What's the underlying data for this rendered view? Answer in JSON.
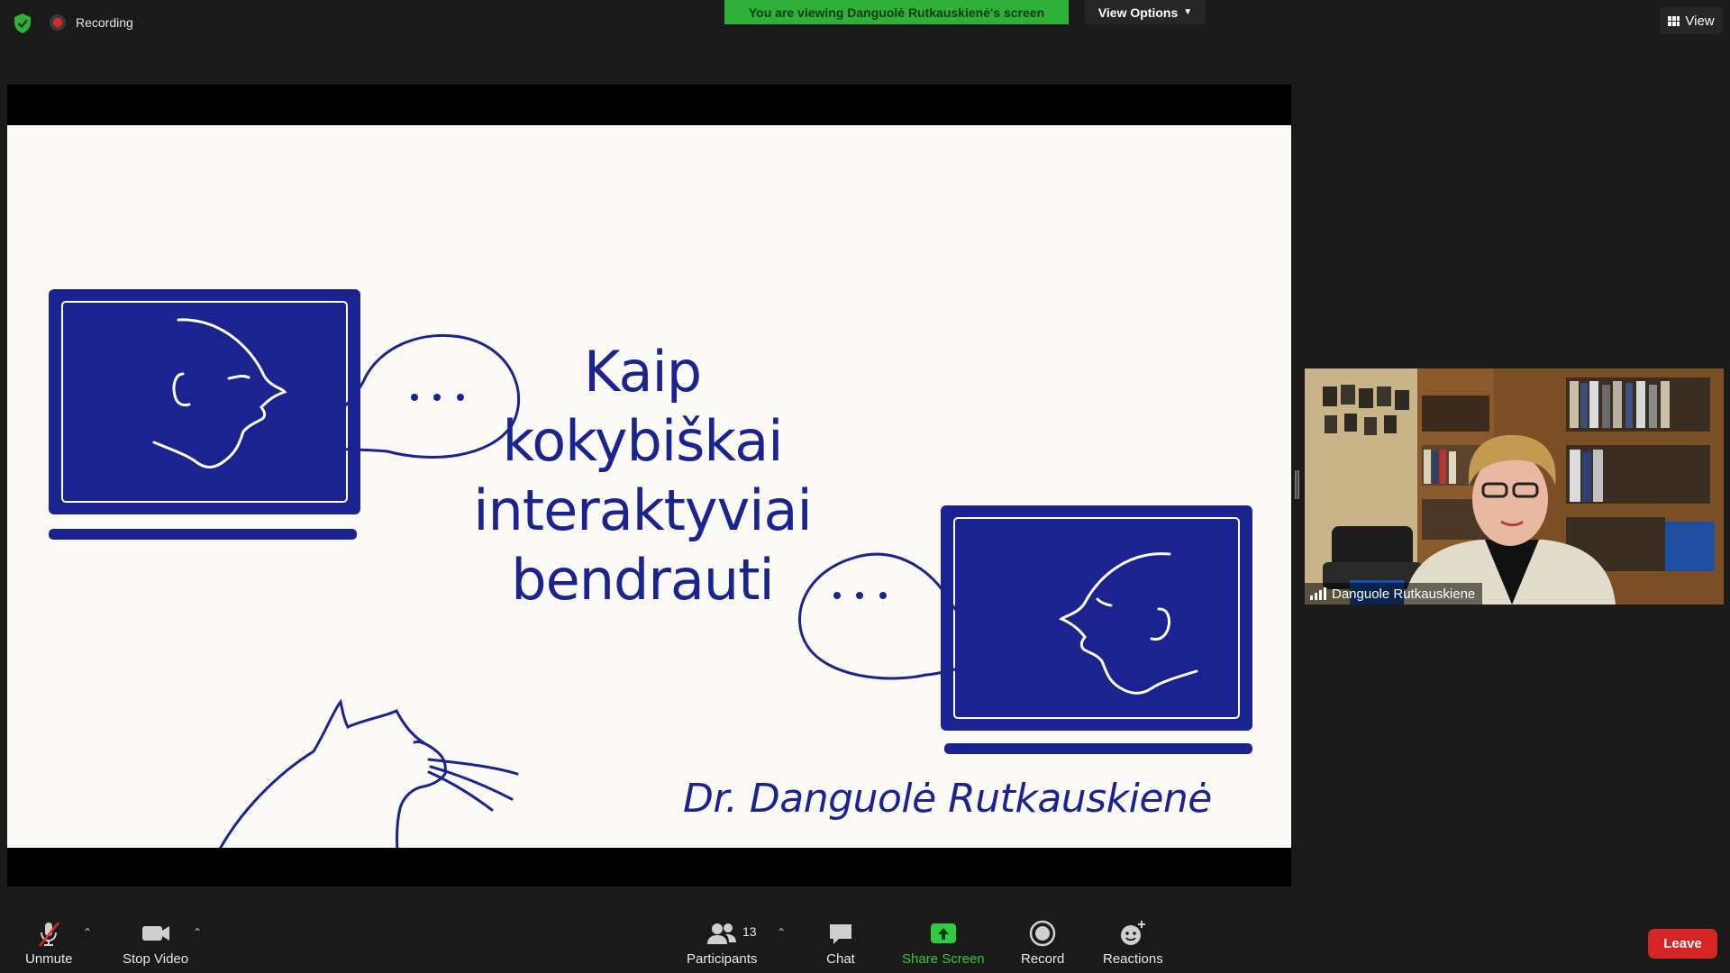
{
  "topbar": {
    "recording_label": "Recording",
    "viewing_banner": "You are viewing Danguolė Rutkauskienė's screen",
    "view_options_label": "View Options",
    "view_label": "View"
  },
  "slide": {
    "title_lines": [
      "Kaip",
      "kokybiškai",
      "interaktyviai",
      "bendrauti"
    ],
    "speech_dots_left": "...",
    "speech_dots_right": "...",
    "author": "Dr. Danguolė Rutkauskienė"
  },
  "video": {
    "participant_name": "Danguole Rutkauskiene"
  },
  "toolbar": {
    "unmute_label": "Unmute",
    "stop_video_label": "Stop Video",
    "participants_label": "Participants",
    "participants_count": "13",
    "chat_label": "Chat",
    "share_screen_label": "Share Screen",
    "record_label": "Record",
    "reactions_label": "Reactions",
    "leave_label": "Leave"
  },
  "colors": {
    "banner_green": "#2eb039",
    "slide_navy": "#1a2390",
    "leave_red": "#d72525",
    "share_green": "#2ecc40"
  }
}
